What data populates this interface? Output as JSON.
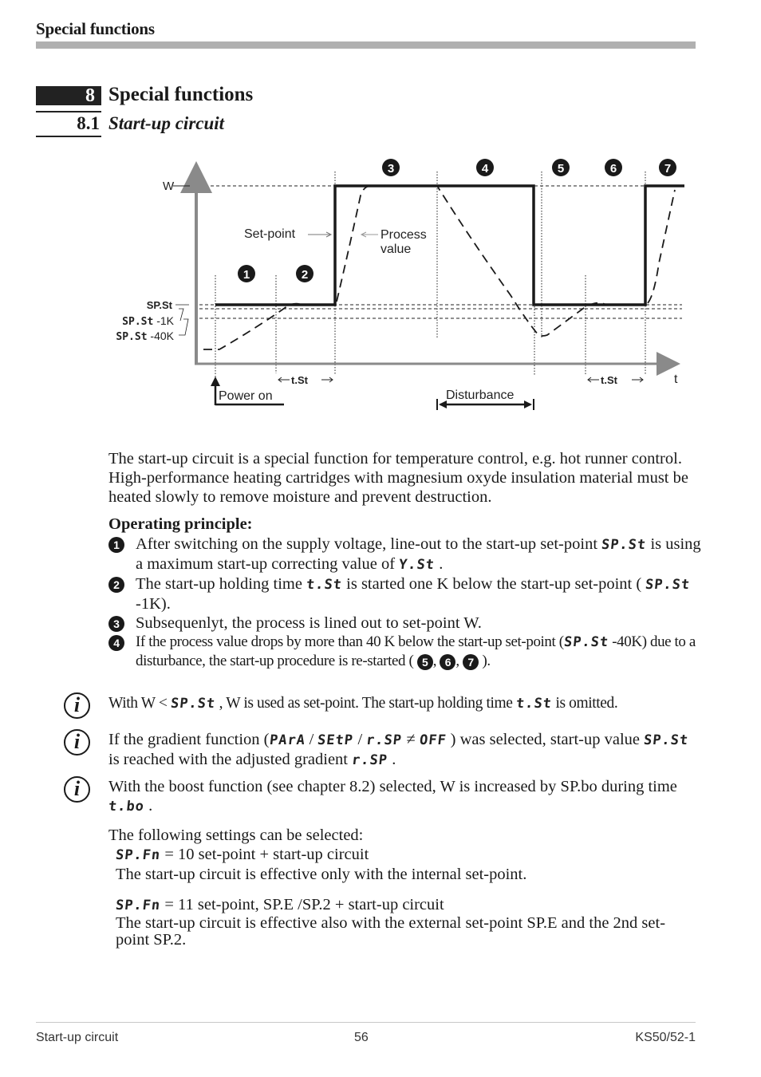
{
  "header": {
    "title": "Special functions"
  },
  "section": {
    "number": "8",
    "title": "Special functions"
  },
  "subsection": {
    "number": "8.1",
    "title": "Start-up circuit"
  },
  "diagram": {
    "y_axis_label": "W",
    "x_axis_label": "t",
    "setpoint_label": "Set-point",
    "process_label_1": "Process",
    "process_label_2": "value",
    "level_labels": [
      {
        "code": "SP.St",
        "suffix": ""
      },
      {
        "code": "SP.St",
        "suffix": "-1K"
      },
      {
        "code": "SP.St",
        "suffix": "-40K"
      }
    ],
    "phase_markers": [
      "1",
      "2",
      "3",
      "4",
      "5",
      "6",
      "7"
    ],
    "holding_time_label": "t.St",
    "power_on_label": "Power on",
    "disturbance_label": "Disturbance",
    "colors": {
      "axis": "#8a8a8a",
      "setpoint": "#1a1a1a",
      "process": "#1a1a1a"
    }
  },
  "intro": "The start-up circuit is a special function for temperature control, e.g. hot runner control. High-performance heating cartridges with magnesium oxyde insulation material must be heated slowly to remove moisture and prevent destruction.",
  "operating": {
    "heading": "Operating principle:",
    "items": [
      {
        "marker": "1",
        "text_a": "After switching on the supply voltage, line-out to the start-up set-point ",
        "code_a": "SP.St",
        "text_b": " is using a maximum start-up correcting value of ",
        "code_b": "Y.St",
        "text_c": " ."
      },
      {
        "marker": "2",
        "text_a": "The start-up holding time ",
        "code_a": "t.St",
        "text_b": "  is started one K below the start-up set-point ( ",
        "code_b": "SP.St",
        "text_c": " -1K)."
      },
      {
        "marker": "3",
        "text_a": "Subsequenlyt, the process is lined out to set-point W."
      },
      {
        "marker": "4",
        "text_a": "If the process value drops by more than 40 K below the start-up set-point (",
        "code_a": "SP.St",
        "text_b": " -40K) due to a disturbance, the start-up procedure is re-started ( ",
        "markers": [
          "5",
          "6",
          "7"
        ],
        "text_c": " )."
      }
    ]
  },
  "notes": [
    {
      "text_a": "With W < ",
      "code_a": "SP.St",
      "text_b": " , W is used as set-point. The start-up holding time ",
      "code_b": "t.St",
      "text_c": "  is omitted."
    },
    {
      "text_a": "If the gradient function (",
      "code_a": "PArA",
      "sep1": " / ",
      "code_b": "SEtP",
      "sep2": " / ",
      "code_c": "r.SP",
      "neq": " ≠ ",
      "code_d": "OFF",
      "text_b": " ) was selected, start-up value ",
      "code_e": "SP.St",
      "text_c": "  is reached with the adjusted gradient ",
      "code_f": "r.SP",
      "text_d": " ."
    },
    {
      "text_a": "With the boost function (see chapter 8.2) selected, W is increased by SP.bo during time ",
      "code_a": "t.bo",
      "text_b": "  ."
    }
  ],
  "settings": {
    "intro": "The following settings can be selected:",
    "options": [
      {
        "code": "SP.Fn",
        "value_text": " = 10 set-point + start-up circuit",
        "description": "The start-up circuit is effective only with the internal set-point."
      },
      {
        "code": "SP.Fn",
        "value_text": " = 11 set-point, SP.E /SP.2 + start-up circuit",
        "description": "The start-up circuit is effective also with the external set-point SP.E and the 2nd set-point SP.2."
      }
    ]
  },
  "footer": {
    "left": "Start-up circuit",
    "page": "56",
    "right": "KS50/52-1"
  }
}
